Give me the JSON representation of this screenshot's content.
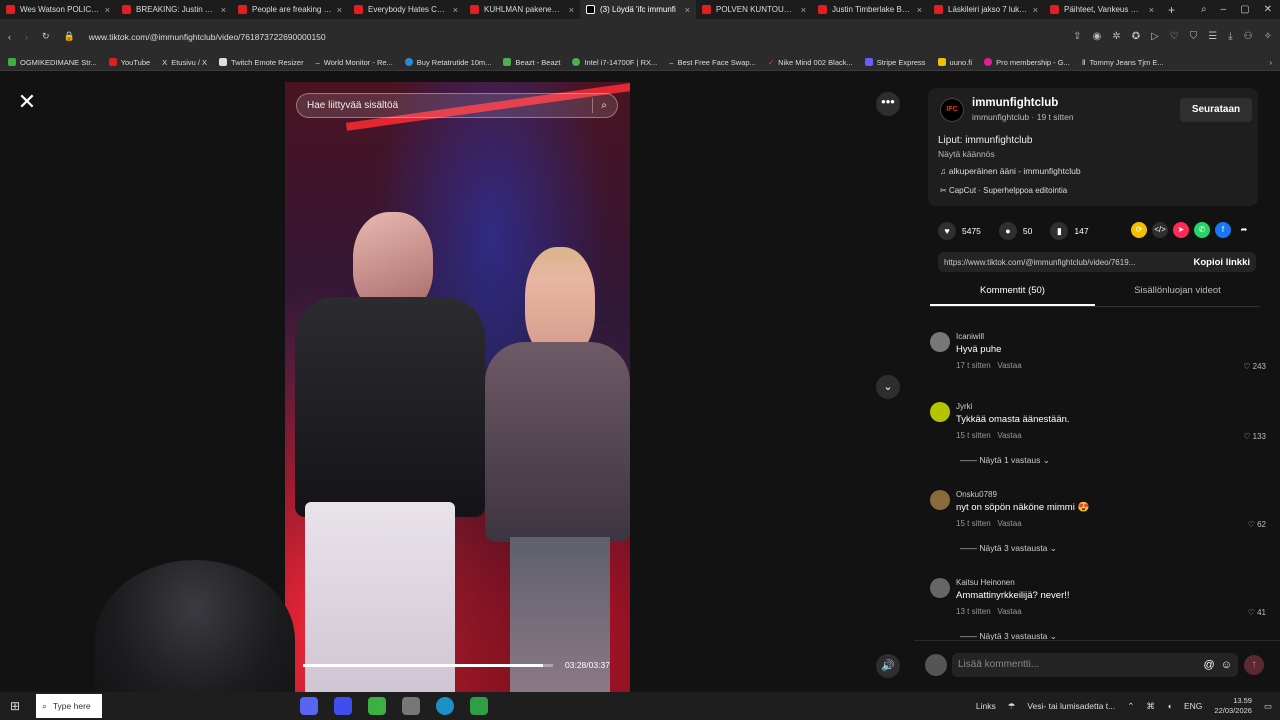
{
  "browser": {
    "tabs": [
      {
        "title": "Wes Watson POLICE REPO",
        "color": "#e02020"
      },
      {
        "title": "BREAKING: Justin Timberl",
        "color": "#e02020"
      },
      {
        "title": "People are freaking out n",
        "color": "#e02020"
      },
      {
        "title": "Everybody Hates Chris: Ju",
        "color": "#e02020"
      },
      {
        "title": "KUHLMAN pakenee pelo",
        "color": "#e02020"
      },
      {
        "title": "(3) Löydä 'ifc immunfi",
        "color": "#ffffff",
        "active": true
      },
      {
        "title": "POLVEN KUNTOUTUS AL",
        "color": "#e02020"
      },
      {
        "title": "Justin Timberlake Bodyca",
        "color": "#e02020"
      },
      {
        "title": "Läskileiri jakso 7 lukkopa",
        "color": "#e02020"
      },
      {
        "title": "Päihteet, Vankeus & Raitt",
        "color": "#e02020"
      }
    ],
    "url": "www.tiktok.com/@immunfightclub/video/761873722690000150",
    "bookmarks": [
      {
        "label": "OGMIKEDIMANE Str...",
        "color": "#3cb043"
      },
      {
        "label": "YouTube",
        "color": "#e02020"
      },
      {
        "label": "Etusivu / X",
        "color": "#ffffff"
      },
      {
        "label": "Twitch Emote Resizer",
        "color": "#dddddd"
      },
      {
        "label": "World Monitor - Re...",
        "color": "#888888"
      },
      {
        "label": "Buy Retatrutide 10m...",
        "color": "#2a8ad6"
      },
      {
        "label": "Beazt - Beazt",
        "color": "#4caf50"
      },
      {
        "label": "Intel i7-14700F | RX...",
        "color": "#4caf50"
      },
      {
        "label": "Best Free Face Swap...",
        "color": "#888888"
      },
      {
        "label": "Nike Mind 002 Black...",
        "color": "#e04040"
      },
      {
        "label": "Stripe Express",
        "color": "#6a5cff"
      },
      {
        "label": "uuno.fi",
        "color": "#f0c000"
      },
      {
        "label": "Pro membership - G...",
        "color": "#e02090"
      },
      {
        "label": "Tommy Jeans Tjm E...",
        "color": "#dddddd"
      }
    ]
  },
  "video": {
    "search_placeholder": "Hae liittyvää sisältöä",
    "time": "03:28/03:37",
    "progress": 0.958
  },
  "author": {
    "avatar_text": "IFC",
    "name": "immunfightclub",
    "sub": "immunfightclub · 19 t sitten",
    "follow_label": "Seurataan",
    "description": "Liput: immunfightclub",
    "translate": "Näytä käännös",
    "sound": "alkuperäinen ääni - immunfightclub",
    "capcut": "CapCut · Superhelppoa editointia"
  },
  "actions": {
    "likes": "5475",
    "comments": "50",
    "saves": "147"
  },
  "link": {
    "url": "https://www.tiktok.com/@immunfightclub/video/7619...",
    "copy_label": "Kopioi linkki"
  },
  "tabs": {
    "comments": "Kommentit (50)",
    "creator_videos": "Sisällönluojan videot"
  },
  "comments": [
    {
      "user": "Icaniwill",
      "text": "Hyvä puhe",
      "time": "17 t sitten",
      "reply": "Vastaa",
      "likes": "243",
      "replies": "",
      "color": "#777777"
    },
    {
      "user": "Jyrki",
      "text": "Tykkää omasta äänestään.",
      "time": "15 t sitten",
      "reply": "Vastaa",
      "likes": "133",
      "replies": "Näytä 1 vastaus",
      "color": "#b5c400"
    },
    {
      "user": "Onsku0789",
      "text": "nyt on söpön näköne mimmi 😍",
      "time": "15 t sitten",
      "reply": "Vastaa",
      "likes": "62",
      "replies": "Näytä 3 vastausta",
      "color": "#8a6a3a"
    },
    {
      "user": "Kaitsu Heinonen",
      "text": "Ammattinyrkkeilijä? never!!",
      "time": "13 t sitten",
      "reply": "Vastaa",
      "likes": "41",
      "replies": "Näytä 3 vastausta",
      "color": "#666666"
    }
  ],
  "comment_input": {
    "placeholder": "Lisää kommentti..."
  },
  "taskbar": {
    "search": "Type here",
    "links": "Links",
    "weather": "Vesi- tai lumisadetta t...",
    "lang": "ENG",
    "time": "13.59",
    "date": "22/03/2026"
  }
}
